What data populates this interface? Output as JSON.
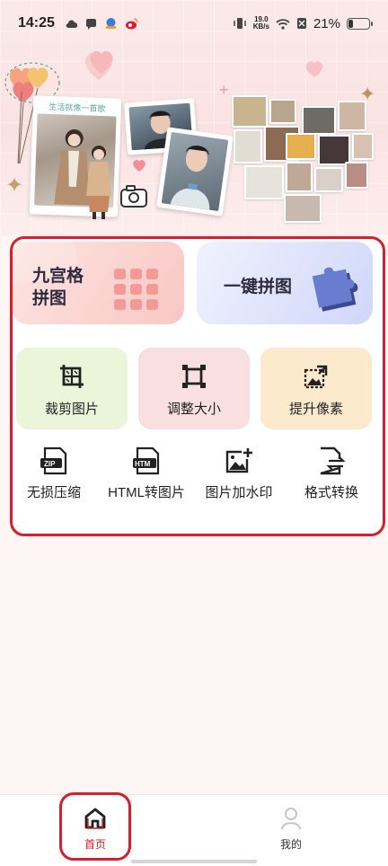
{
  "status_bar": {
    "time": "14:25",
    "net_speed_value": "19.0",
    "net_speed_unit": "KB/s",
    "battery": "21%",
    "battery_level": 0.21
  },
  "banner": {
    "photo_caption": "生活就像一首歌"
  },
  "features": {
    "nine_grid": {
      "label_line1": "九宫格",
      "label_line2": "拼图",
      "color": "#fbd3cf"
    },
    "one_click": {
      "label": "一键拼图",
      "color": "#d9def9"
    },
    "crop": {
      "label": "裁剪图片",
      "color": "#eaf5d9",
      "icon": "crop-grid-icon"
    },
    "resize": {
      "label": "调整大小",
      "color": "#f9dfe0",
      "icon": "resize-frame-icon"
    },
    "upscale": {
      "label": "提升像素",
      "color": "#fdeacd",
      "icon": "upscale-image-icon"
    }
  },
  "tools": [
    {
      "label": "无损压缩",
      "icon": "zip-file-icon"
    },
    {
      "label": "HTML转图片",
      "icon": "htm-file-icon"
    },
    {
      "label": "图片加水印",
      "icon": "image-plus-icon"
    },
    {
      "label": "格式转换",
      "icon": "file-convert-icon"
    }
  ],
  "nav": {
    "home": {
      "label": "首页",
      "active_color": "#d61f2c"
    },
    "mine": {
      "label": "我的"
    }
  },
  "highlight_color": "#d61f2c"
}
